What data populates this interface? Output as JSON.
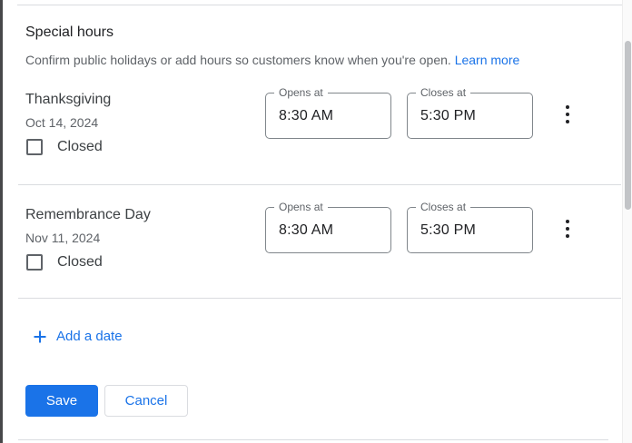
{
  "header": {
    "title": "Special hours",
    "description": "Confirm public holidays or add hours so customers know when you're open.",
    "learn_more_label": "Learn more"
  },
  "rows": [
    {
      "name": "Thanksgiving",
      "date": "Oct 14, 2024",
      "closed_label": "Closed",
      "closed_checked": false,
      "opens_label": "Opens at",
      "opens_value": "8:30 AM",
      "closes_label": "Closes at",
      "closes_value": "5:30 PM",
      "menu_icon": "kebab-menu-icon"
    },
    {
      "name": "Remembrance Day",
      "date": "Nov 11, 2024",
      "closed_label": "Closed",
      "closed_checked": false,
      "opens_label": "Opens at",
      "opens_value": "8:30 AM",
      "closes_label": "Closes at",
      "closes_value": "5:30 PM",
      "menu_icon": "kebab-menu-icon"
    }
  ],
  "footer": {
    "add_date_label": "Add a date",
    "add_icon": "plus-icon",
    "save_label": "Save",
    "cancel_label": "Cancel"
  },
  "colors": {
    "accent": "#1a73e8",
    "text_primary": "#202124",
    "text_secondary": "#5f6368",
    "divider": "#dadce0",
    "field_border": "#80868b"
  }
}
